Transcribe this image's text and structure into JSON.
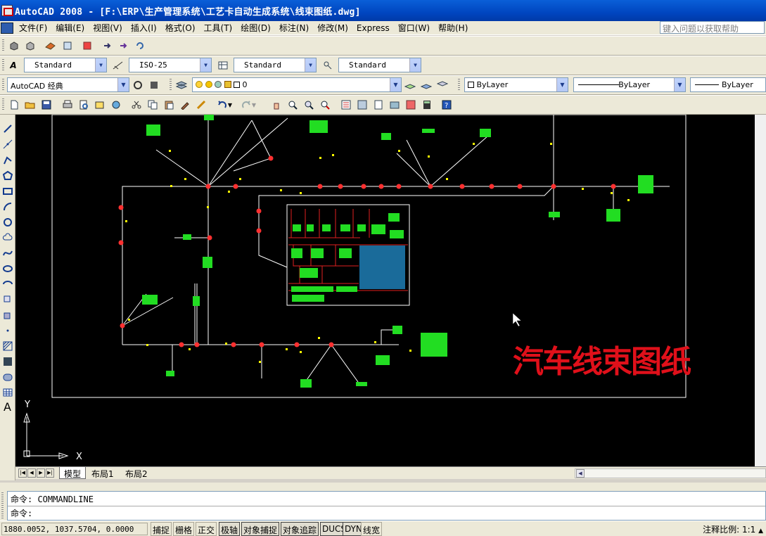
{
  "window": {
    "title": "AutoCAD 2008 - [F:\\ERP\\生产管理系统\\工艺卡自动生成系统\\线束图纸.dwg]",
    "icon": "autocad-icon"
  },
  "menu": {
    "items": [
      "文件(F)",
      "编辑(E)",
      "视图(V)",
      "插入(I)",
      "格式(O)",
      "工具(T)",
      "绘图(D)",
      "标注(N)",
      "修改(M)",
      "Express",
      "窗口(W)",
      "帮助(H)"
    ],
    "help_placeholder": "键入问题以获取帮助"
  },
  "styles": {
    "text_style": "Standard",
    "dim_style": "ISO-25",
    "table_style": "Standard",
    "multileader_style": "Standard"
  },
  "workspace": "AutoCAD 经典",
  "layer": {
    "current": "0",
    "color": "ByLayer",
    "linetype": "ByLayer",
    "lineweight": "ByLayer"
  },
  "drawing": {
    "overlay_text": "汽车线束图纸",
    "overlay_color": "#e0101a",
    "background": "#000000",
    "wire_color": "#ffffff",
    "component_color": "#22dd22",
    "connector_color": "#ff3030",
    "label_color": "#ffff00",
    "panel_fill": "#1a6b9a",
    "ucs_x": "X",
    "ucs_y": "Y"
  },
  "layout_tabs": [
    "模型",
    "布局1",
    "布局2"
  ],
  "active_tab": "模型",
  "command": {
    "prompt1": "命令: COMMANDLINE",
    "prompt2": "命令:"
  },
  "status": {
    "coords": "1880.0052, 1037.5704, 0.0000",
    "buttons": [
      {
        "label": "捕捉",
        "on": false
      },
      {
        "label": "栅格",
        "on": false
      },
      {
        "label": "正交",
        "on": false
      },
      {
        "label": "极轴",
        "on": true
      },
      {
        "label": "对象捕捉",
        "on": true
      },
      {
        "label": "对象追踪",
        "on": true
      },
      {
        "label": "DUCS",
        "on": true
      },
      {
        "label": "DYN",
        "on": true
      },
      {
        "label": "线宽",
        "on": false
      }
    ],
    "annotation_label": "注释比例:",
    "annotation_value": "1:1"
  }
}
